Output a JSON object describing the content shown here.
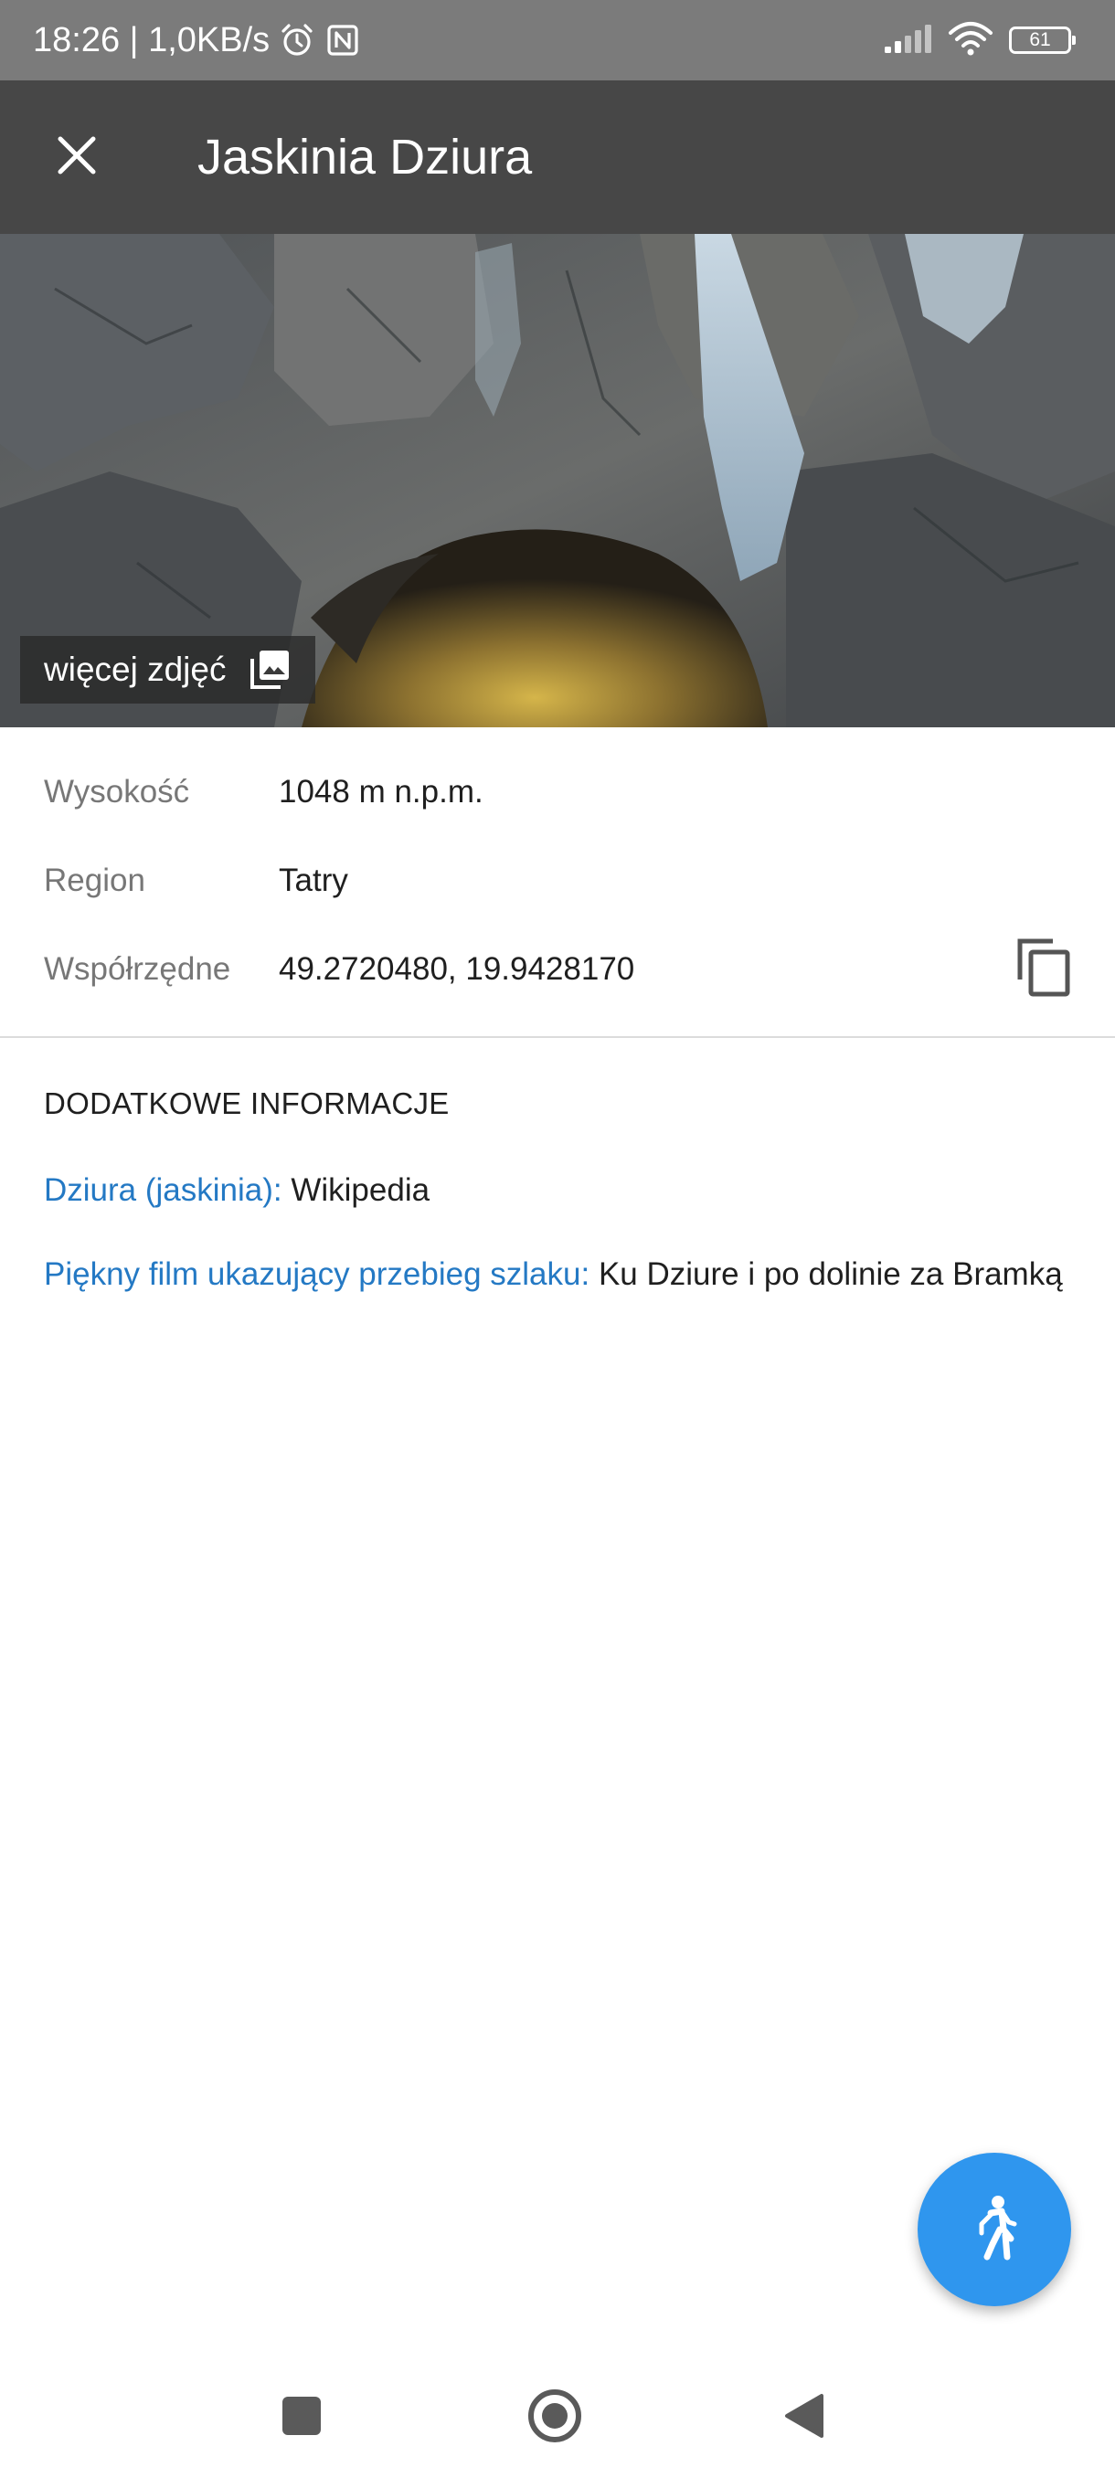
{
  "status_bar": {
    "time_speed": "18:26 | 1,0KB/s",
    "battery_level": "61",
    "icons": [
      "alarm-icon",
      "nfc-icon",
      "signal-icon",
      "wifi-icon",
      "battery-icon"
    ]
  },
  "app_bar": {
    "title": "Jaskinia Dziura",
    "close_icon": "close-icon"
  },
  "hero": {
    "more_photos_label": "więcej zdjęć",
    "icon": "photo-library-icon"
  },
  "info": {
    "rows": [
      {
        "label": "Wysokość",
        "value": "1048 m n.p.m."
      },
      {
        "label": "Region",
        "value": "Tatry"
      },
      {
        "label": "Współrzędne",
        "value": "49.2720480, 19.9428170"
      }
    ],
    "copy_icon": "copy-icon"
  },
  "extra": {
    "title": "DODATKOWE INFORMACJE",
    "links": [
      {
        "link_text": "Dziura (jaskinia):",
        "rest": " Wikipedia"
      },
      {
        "link_text": "Piękny film ukazujący przebieg szlaku:",
        "rest": " Ku Dziure i po dolinie za Bramką"
      }
    ]
  },
  "fab": {
    "icon": "walk-icon"
  },
  "nav_bar": {
    "icons": [
      "recents-icon",
      "home-icon",
      "back-icon"
    ]
  },
  "colors": {
    "status_bar": "#7b7b7b",
    "app_bar": "#474747",
    "link": "#2479c4",
    "fab": "#2f96ee"
  }
}
